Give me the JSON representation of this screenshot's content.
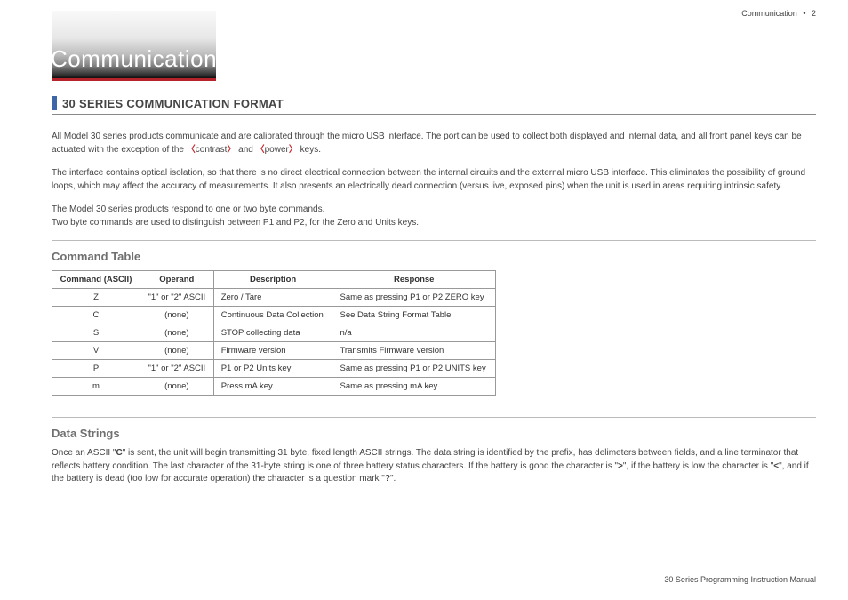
{
  "header": {
    "breadcrumb_text": "Communication",
    "breadcrumb_bullet": "•",
    "breadcrumb_page": "2",
    "title": "Communication"
  },
  "section": {
    "title": "30 SERIES COMMUNICATION FORMAT"
  },
  "paragraphs": {
    "p1a": "All Model 30 series products communicate and are calibrated through the micro USB interface. The port can be used to collect both displayed and internal data, and all front panel keys can be actuated with the exception of the ",
    "brace_open": "〈",
    "p1_contrast": "contrast",
    "brace_close": "〉",
    "p1_and": " and ",
    "p1_power": "power",
    "p1_end": " keys.",
    "p2": "The interface contains optical isolation, so that there is no direct electrical connection between the internal circuits and the external micro USB interface. This eliminates the possibility of ground loops, which may affect the accuracy of measurements. It also presents an electrically dead connection (versus live, exposed pins) when the unit is used in areas requiring intrinsic safety.",
    "p3": "The Model 30 series products respond to one or two byte commands.\nTwo byte commands are used to distinguish between P1 and P2, for the Zero and Units keys."
  },
  "command_table": {
    "heading": "Command Table",
    "headers": [
      "Command (ASCII)",
      "Operand",
      "Description",
      "Response"
    ],
    "rows": [
      [
        "Z",
        "\"1\" or \"2\" ASCII",
        "Zero / Tare",
        "Same as pressing P1 or P2 ZERO key"
      ],
      [
        "C",
        "(none)",
        "Continuous Data Collection",
        "See Data String Format Table"
      ],
      [
        "S",
        "(none)",
        "STOP collecting data",
        "n/a"
      ],
      [
        "V",
        "(none)",
        "Firmware version",
        "Transmits Firmware version"
      ],
      [
        "P",
        "\"1\" or \"2\" ASCII",
        "P1 or P2 Units key",
        "Same as pressing P1 or P2 UNITS key"
      ],
      [
        "m",
        "(none)",
        "Press mA key",
        "Same as pressing mA key"
      ]
    ]
  },
  "data_strings": {
    "heading": "Data Strings",
    "para_a": "Once an ASCII \"",
    "para_bold_c": "C",
    "para_b": "\" is sent, the unit will begin transmitting 31 byte, fixed length ASCII strings. The data string is identified by the prefix, has delimeters between fields, and a line terminator that reflects battery condition. The last character of the 31-byte string is one of three battery status characters. If the battery is good the character is \"",
    "sym_gt": ">",
    "para_c": "\", if the battery is low the character is \"",
    "sym_lt": "<",
    "para_d": "\", and if the battery is dead (too low for accurate operation) the character is a question mark \"",
    "sym_q": "?",
    "para_e": "\"."
  },
  "footer": {
    "text": "30 Series Programming Instruction Manual"
  }
}
